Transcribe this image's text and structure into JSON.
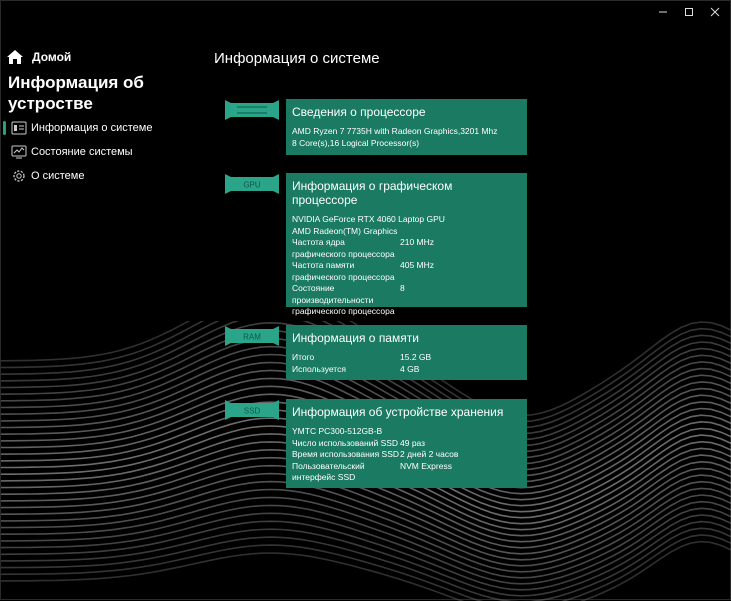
{
  "window": {
    "controls": {
      "minimize": "minimize-icon",
      "maximize": "maximize-icon",
      "close": "close-icon"
    }
  },
  "sidebar": {
    "home_label": "Домой",
    "title": "Информация об устростве",
    "items": [
      {
        "label": "Информация о системе",
        "icon": "system-info-icon",
        "active": true
      },
      {
        "label": "Состояние системы",
        "icon": "system-status-icon",
        "active": false
      },
      {
        "label": "О системе",
        "icon": "gear-icon",
        "active": false
      }
    ]
  },
  "main": {
    "title": "Информация о системе",
    "cpu": {
      "chip_label": "",
      "heading": "Сведения о процессоре",
      "name": "AMD Ryzen 7 7735H with Radeon Graphics,3201 Mhz",
      "cores": "8 Core(s),16 Logical Processor(s)"
    },
    "gpu": {
      "chip_label": "GPU",
      "heading": "Информация о графическом процессоре",
      "gpu1": "NVIDIA GeForce RTX 4060 Laptop GPU",
      "gpu2": "AMD Radeon(TM) Graphics",
      "rows": [
        {
          "k": "Частота ядра графического процессора",
          "v": "210 MHz"
        },
        {
          "k": "Частота памяти графического процессора",
          "v": "405 MHz"
        },
        {
          "k": "Состояние производительности графического процессора",
          "v": "8"
        }
      ]
    },
    "ram": {
      "chip_label": "RAM",
      "heading": "Информация о памяти",
      "rows": [
        {
          "k": "Итого",
          "v": "15.2 GB"
        },
        {
          "k": "Используется",
          "v": "4 GB"
        }
      ]
    },
    "ssd": {
      "chip_label": "SSD",
      "heading": "Информация об устройстве хранения",
      "model": "YMTC PC300-512GB-B",
      "rows": [
        {
          "k": "Число использований SSD",
          "v": "49 раз"
        },
        {
          "k": "Время использования SSD",
          "v": "2 дней 2 часов"
        },
        {
          "k": "Пользовательский интерфейс SSD",
          "v": "NVM Express"
        }
      ]
    }
  },
  "colors": {
    "accent": "#1a7a62",
    "chip": "#2aa58a",
    "background": "#000000"
  }
}
